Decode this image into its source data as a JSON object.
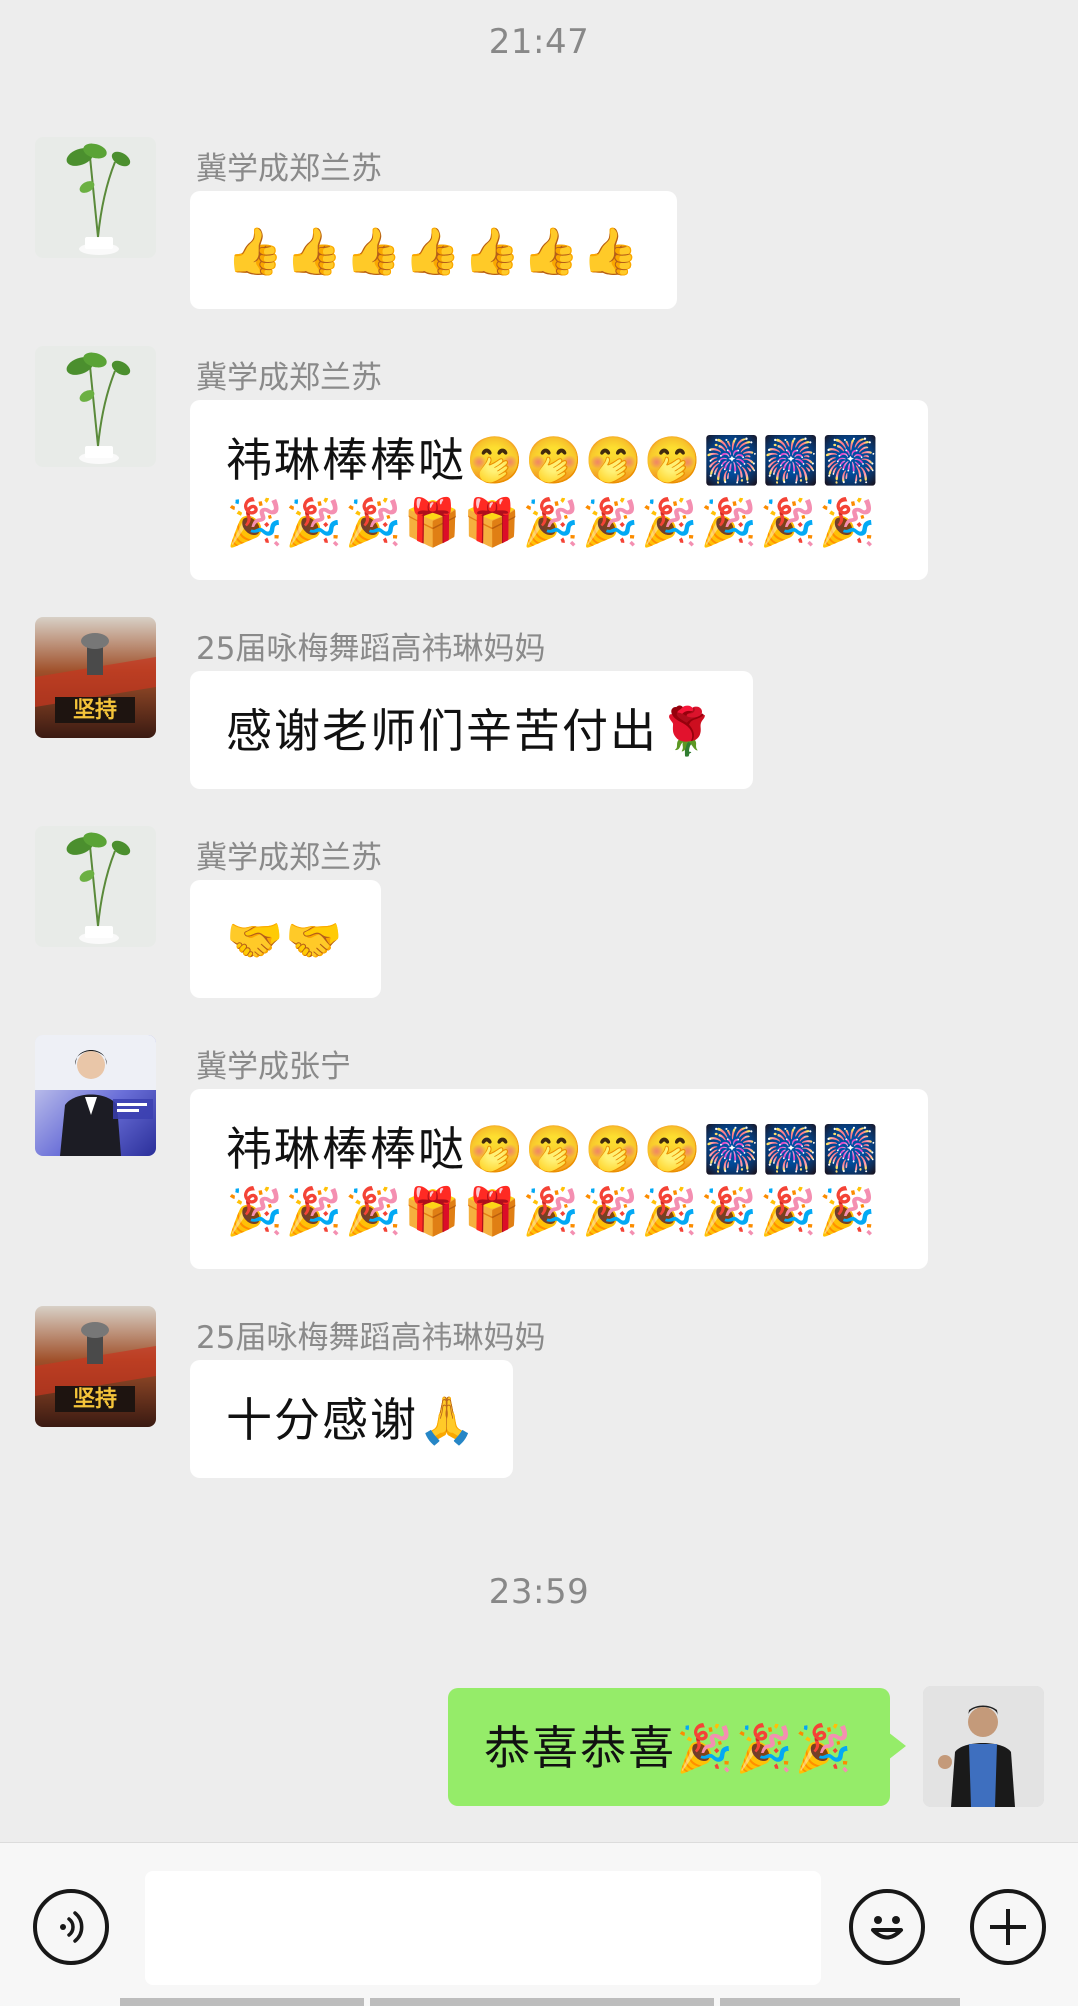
{
  "timestamps": [
    "21:47",
    "23:59"
  ],
  "messages": [
    {
      "sender": "冀学成郑兰苏",
      "text": "👍👍👍👍👍👍👍"
    },
    {
      "sender": "冀学成郑兰苏",
      "text": "祎琳棒棒哒🤭🤭🤭🤭🎆🎆🎆🎉🎉🎉🎁🎁🎉🎉🎉🎉🎉🎉"
    },
    {
      "sender": "25届咏梅舞蹈高祎琳妈妈",
      "text": "感谢老师们辛苦付出🌹",
      "avatar_text": "坚持"
    },
    {
      "sender": "冀学成郑兰苏",
      "text": "🤝🤝"
    },
    {
      "sender": "冀学成张宁",
      "text": "祎琳棒棒哒🤭🤭🤭🤭🎆🎆🎆🎉🎉🎉🎁🎁🎉🎉🎉🎉🎉🎉"
    },
    {
      "sender": "25届咏梅舞蹈高祎琳妈妈",
      "text": "十分感谢🙏",
      "avatar_text": "坚持"
    }
  ],
  "self_message": {
    "text": "恭喜恭喜🎉🎉🎉"
  },
  "input": {
    "placeholder": ""
  },
  "icons": {
    "voice": "voice-icon",
    "emoji": "emoji-icon",
    "plus": "plus-icon"
  },
  "colors": {
    "background": "#ededed",
    "incoming_bubble": "#ffffff",
    "outgoing_bubble": "#95ec69",
    "sender_name": "#8a8a8a"
  }
}
